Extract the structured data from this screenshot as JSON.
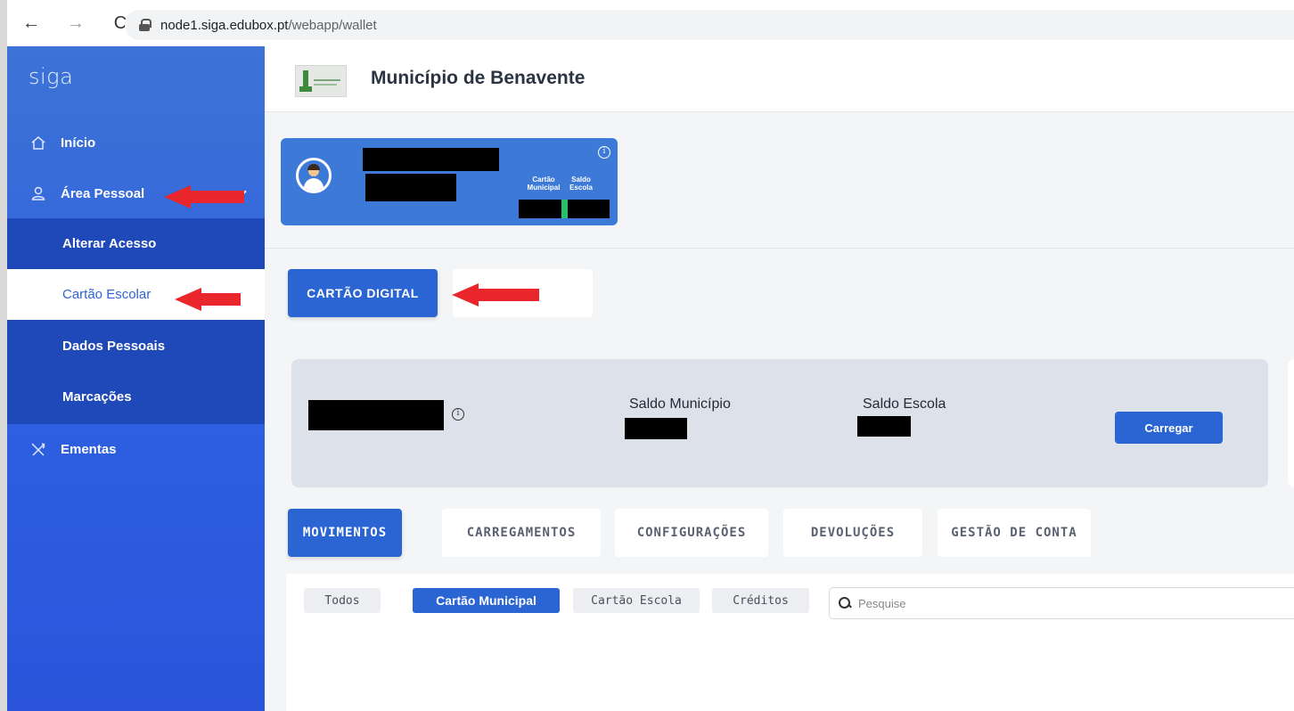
{
  "browser": {
    "back": "←",
    "forward": "→",
    "reload": "C",
    "url_host": "node1.siga.edubox.pt",
    "url_path": "/webapp/wallet"
  },
  "sidebar": {
    "brand": "siga",
    "items": [
      {
        "label": "Início",
        "icon": "home-icon"
      },
      {
        "label": "Área Pessoal",
        "icon": "user-icon"
      },
      {
        "label": "Ementas",
        "icon": "cutlery-icon"
      }
    ],
    "submenu": [
      {
        "label": "Alterar Acesso"
      },
      {
        "label": "Cartão Escolar"
      },
      {
        "label": "Dados Pessoais"
      },
      {
        "label": "Marcações"
      }
    ]
  },
  "header": {
    "title": "Município de Benavente"
  },
  "profile": {
    "label_municipal": "Cartão Municipal",
    "label_escola": "Saldo Escola",
    "info_symbol": "i"
  },
  "actions": {
    "digital_card": "CARTÃO DIGITAL"
  },
  "balance": {
    "saldo_municipio": "Saldo Município",
    "saldo_escola": "Saldo Escola",
    "carregar": "Carregar",
    "info_symbol": "i"
  },
  "tabs": [
    {
      "label": "MOVIMENTOS",
      "active": true
    },
    {
      "label": "CARREGAMENTOS",
      "active": false
    },
    {
      "label": "CONFIGURAÇÕES",
      "active": false
    },
    {
      "label": "DEVOLUÇÕES",
      "active": false
    },
    {
      "label": "GESTÃO DE CONTA",
      "active": false
    }
  ],
  "filters": [
    {
      "label": "Todos",
      "active": false
    },
    {
      "label": "Cartão Municipal",
      "active": true
    },
    {
      "label": "Cartão Escola",
      "active": false
    },
    {
      "label": "Créditos",
      "active": false
    }
  ],
  "search": {
    "placeholder": "Pesquise"
  },
  "colors": {
    "primary": "#2b64d3",
    "sidebar": "#3d73d6",
    "submenu": "#1f48b8",
    "annotation_arrow": "#e8262b"
  }
}
